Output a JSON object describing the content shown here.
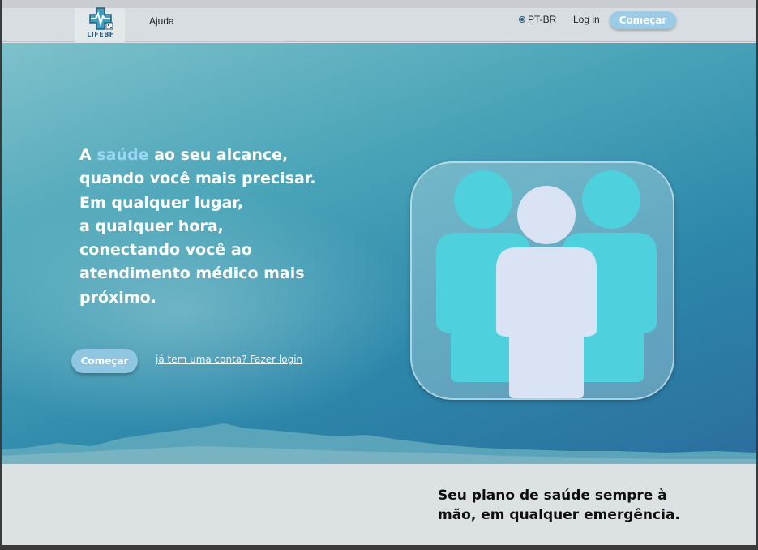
{
  "brand": {
    "name": "LIFEBF",
    "logo_icon": "medical-cross-heartbeat-icon"
  },
  "nav": {
    "help": "Ajuda",
    "language": "PT-BR",
    "login": "Log in",
    "start": "Começar"
  },
  "hero": {
    "headline_prefix": "A ",
    "headline_highlight": "saúde",
    "headline_lines": [
      " ao seu alcance,",
      "quando você mais  precisar.",
      "Em qualquer lugar,",
      "a qualquer hora,",
      "conectando você ao",
      "atendimento médico mais",
      "próximo."
    ],
    "start_button": "Começar",
    "login_link": "já tem uma conta? Fazer login",
    "illustration_icon": "group-of-people-icon"
  },
  "section2": {
    "tagline_line1": "Seu plano de saúde sempre à",
    "tagline_line2": "mão, em qualquer emergência."
  },
  "colors": {
    "accent": "#9ccbe8",
    "highlight": "#9ad7f6",
    "hero_dark": "#2b6e9e",
    "people_teal": "#4fd0dd",
    "people_light": "#d9e3f3"
  }
}
